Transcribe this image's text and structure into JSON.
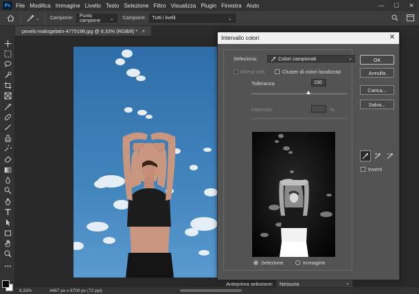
{
  "app": {
    "logo": "Ps"
  },
  "menu": [
    "File",
    "Modifica",
    "Immagine",
    "Livello",
    "Testo",
    "Selezione",
    "Filtro",
    "Visualizza",
    "Plugin",
    "Finestra",
    "Aiuto"
  ],
  "window_controls": {
    "minimize": "—",
    "maximize": "☐",
    "close": "✕"
  },
  "options": {
    "sample_label": "Campione:",
    "sample_value": "Punto campione",
    "sample2_label": "Campione:",
    "sample2_value": "Tutti i livelli"
  },
  "document": {
    "tab_title": "pexels-maksgelatin-4775198.jpg @ 8,33% (RGB/8) *",
    "tab_close": "×",
    "zoom": "8,33%",
    "info": "4467 px x 6700 px (72 ppi)"
  },
  "dialog": {
    "title": "Intervallo colori",
    "close": "✕",
    "selection_label": "Seleziona:",
    "selection_value": "Colori campionati",
    "detect_faces_label": "Rileva volti",
    "localized_clusters_label": "Cluster di colori localizzati",
    "tolerance_label": "Tolleranza",
    "tolerance_value": "150",
    "tolerance_fraction": 0.59,
    "range_label": "Intervallo:",
    "range_unit": "%",
    "radio_selection": "Selezione",
    "radio_image": "Immagine",
    "preview_label": "Anteprima selezione:",
    "preview_value": "Nessuna",
    "buttons": {
      "ok": "OK",
      "reset": "Annulla",
      "load": "Carica...",
      "save": "Salva..."
    },
    "invert_label": "Inverti"
  },
  "colors": {
    "menubar": "#323232",
    "panel": "#535353",
    "canvas": "#282828",
    "sky": "#3f7fb5"
  }
}
